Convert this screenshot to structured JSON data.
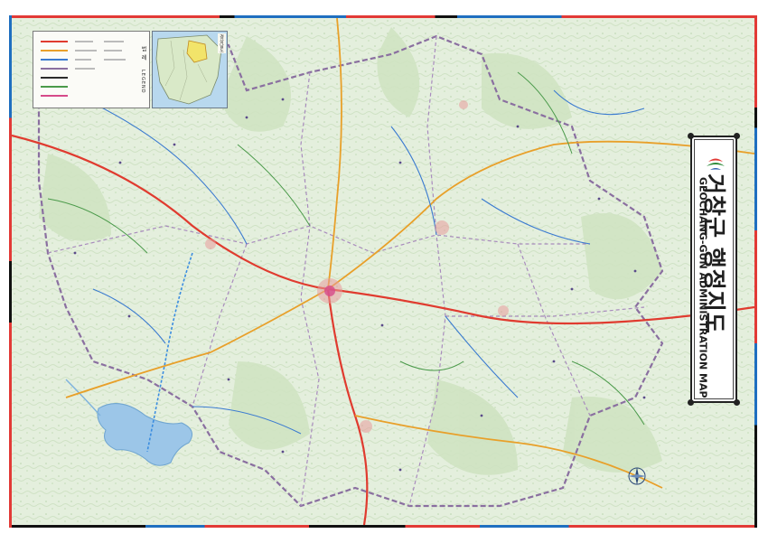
{
  "map": {
    "title_korean": "거창군 행정지도",
    "title_english": "GEOCHANG-GUN ADMINISTRATION MAP",
    "legend_heading": "범 례",
    "legend_heading_en": "LEGEND",
    "colors": {
      "land": "#e6f0e0",
      "forest": "#cfe3c2",
      "water": "#9cc6e8",
      "boundary": "#8a6fa0",
      "highway": "#e03b2f",
      "national_road": "#e8a02a",
      "local_road": "#3b7bd0",
      "rail": "#2c2c2c",
      "frame_red": "#e23a36",
      "frame_blue": "#1f6fc0",
      "frame_black": "#111111"
    },
    "icons": [
      "logo-icon",
      "compass-icon"
    ]
  }
}
